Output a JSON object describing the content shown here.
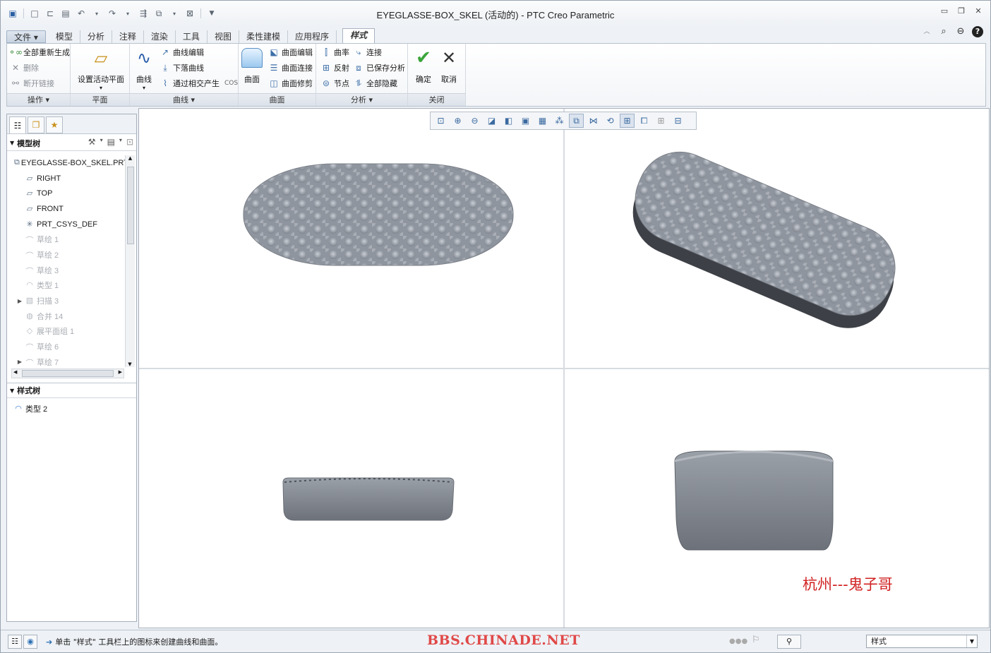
{
  "window": {
    "title": "EYEGLASSE-BOX_SKEL (活动的) - PTC Creo Parametric"
  },
  "menu_tabs": [
    "文件",
    "模型",
    "分析",
    "注释",
    "渲染",
    "工具",
    "视图",
    "柔性建模",
    "应用程序"
  ],
  "active_tab": "样式",
  "ribbon": {
    "operations": {
      "regen_all": "全部重新生成",
      "delete": "删除",
      "break_link": "断开链接",
      "footer": "操作"
    },
    "plane": {
      "set_active_plane": "设置活动平面",
      "footer": "平面"
    },
    "curves": {
      "curve": "曲线",
      "curve_edit": "曲线编辑",
      "drop_curve": "下落曲线",
      "intersect": "通过相交产生",
      "cos": "COS",
      "footer": "曲线"
    },
    "surfaces": {
      "surface": "曲面",
      "surface_edit": "曲面编辑",
      "surface_connect": "曲面连接",
      "surface_trim": "曲面修剪",
      "footer": "曲面"
    },
    "analysis": {
      "curvature": "曲率",
      "connect": "连接",
      "reflection": "反射",
      "saved_analysis": "已保存分析",
      "node": "节点",
      "hide_all": "全部隐藏",
      "footer": "分析"
    },
    "close": {
      "ok": "确定",
      "cancel": "取消",
      "footer": "关闭"
    }
  },
  "model_tree": {
    "header": "模型树",
    "items": [
      {
        "label": "EYEGLASSE-BOX_SKEL.PRT",
        "icon": "part-icon",
        "suppressed": false,
        "expandable": false
      },
      {
        "label": "RIGHT",
        "icon": "datum-plane-icon",
        "suppressed": false,
        "expandable": false
      },
      {
        "label": "TOP",
        "icon": "datum-plane-icon",
        "suppressed": false,
        "expandable": false
      },
      {
        "label": "FRONT",
        "icon": "datum-plane-icon",
        "suppressed": false,
        "expandable": false
      },
      {
        "label": "PRT_CSYS_DEF",
        "icon": "csys-icon",
        "suppressed": false,
        "expandable": false
      },
      {
        "label": "草绘 1",
        "icon": "sketch-icon",
        "suppressed": true,
        "expandable": false
      },
      {
        "label": "草绘 2",
        "icon": "sketch-icon",
        "suppressed": true,
        "expandable": false
      },
      {
        "label": "草绘 3",
        "icon": "sketch-icon",
        "suppressed": true,
        "expandable": false
      },
      {
        "label": "类型 1",
        "icon": "style-icon",
        "suppressed": true,
        "expandable": false
      },
      {
        "label": "扫描 3",
        "icon": "sweep-icon",
        "suppressed": true,
        "expandable": true
      },
      {
        "label": "合并 14",
        "icon": "merge-icon",
        "suppressed": true,
        "expandable": false
      },
      {
        "label": "展平面组 1",
        "icon": "flatten-icon",
        "suppressed": true,
        "expandable": false
      },
      {
        "label": "草绘 6",
        "icon": "sketch-icon",
        "suppressed": true,
        "expandable": false
      },
      {
        "label": "草绘 7",
        "icon": "sketch-icon",
        "suppressed": true,
        "expandable": true
      }
    ]
  },
  "style_tree": {
    "header": "样式树",
    "items": [
      {
        "label": "类型 2",
        "icon": "style-icon"
      }
    ]
  },
  "viewport": {
    "watermark": "杭州---鬼子哥",
    "model_color": "#8e939b"
  },
  "status": {
    "message": "单击 \"样式\" 工具栏上的图标来创建曲线和曲面。",
    "brand": "BBS.CHINADE.NET",
    "filter_value": "样式"
  }
}
